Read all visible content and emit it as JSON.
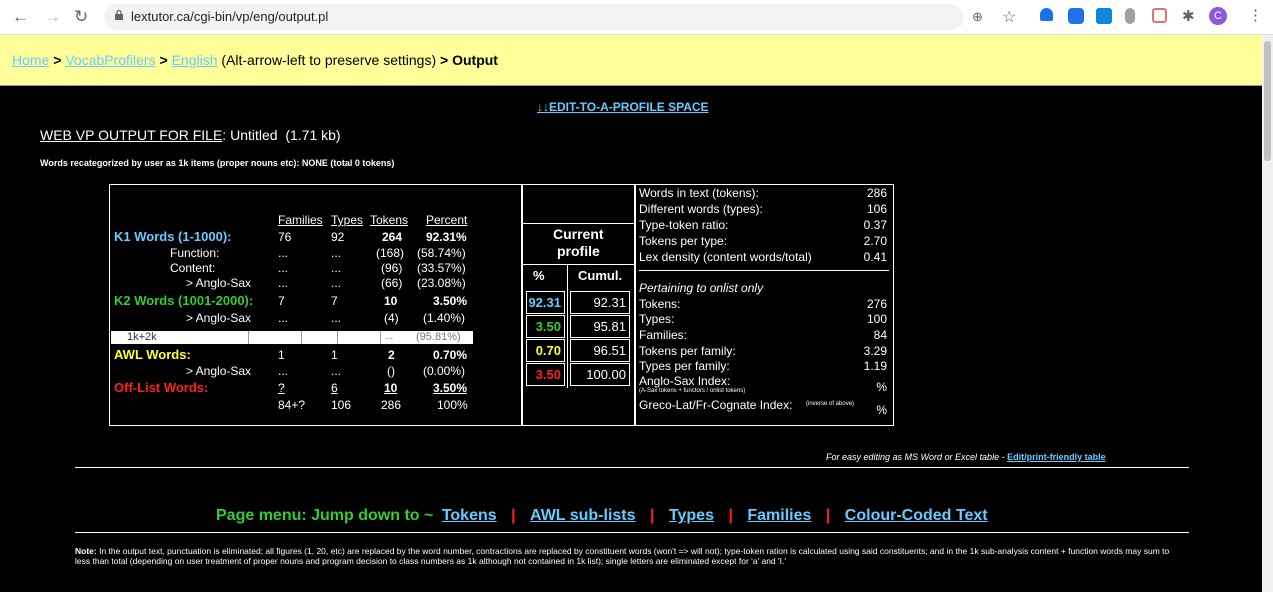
{
  "browser": {
    "url": "lextutor.ca/cgi-bin/vp/eng/output.pl"
  },
  "breadcrumb": {
    "home": "Home",
    "sep1": ">",
    "vocabprofilers": "VocabProfilers",
    "sep2": ">",
    "english": "English",
    "hint": "(Alt-arrow-left to preserve settings)",
    "sep3": ">",
    "output": "Output"
  },
  "edit_link": "↓↓EDIT-TO-A-PROFILE SPACE",
  "vp_title": {
    "label": "WEB VP OUTPUT FOR FILE",
    "colon": ":",
    "file": "Untitled",
    "size": "(1.71 kb)"
  },
  "recategorized": "Words recategorized by user as 1k items (proper nouns etc): NONE (total 0 tokens)",
  "table": {
    "headers": {
      "families": "Families",
      "types": "Types",
      "tokens": "Tokens",
      "percent": "Percent"
    },
    "k1": {
      "label": "K1 Words (1-1000):",
      "families": "76",
      "types": "92",
      "tokens": "264",
      "percent": "92.31%"
    },
    "function": {
      "label": "Function:",
      "families": "...",
      "types": "...",
      "tokens": "(168)",
      "percent": "(58.74%)"
    },
    "content": {
      "label": "Content:",
      "families": "...",
      "types": "...",
      "tokens": "(96)",
      "percent": "(33.57%)"
    },
    "anglosax1": {
      "label": ">  Anglo-Sax",
      "families": "...",
      "types": "...",
      "tokens": "(66)",
      "percent": "(23.08%)"
    },
    "k2": {
      "label": "K2 Words (1001-2000):",
      "families": "7",
      "types": "7",
      "tokens": "10",
      "percent": "3.50%"
    },
    "anglosax2": {
      "label": ">  Anglo-Sax",
      "families": "...",
      "types": "...",
      "tokens": "(4)",
      "percent": "(1.40%)"
    },
    "k1k2": {
      "label": "1k+2k",
      "tokens": "...",
      "percent": "(95.81%)"
    },
    "awl": {
      "label": "AWL Words:",
      "families": "1",
      "types": "1",
      "tokens": "2",
      "percent": "0.70%"
    },
    "anglosax3": {
      "label": ">  Anglo-Sax",
      "families": "...",
      "types": "...",
      "tokens": "()",
      "percent": "(0.00%)"
    },
    "offlist": {
      "label": "Off-List Words:",
      "families": "?",
      "types": "6",
      "tokens": "10",
      "percent": "3.50%"
    },
    "total": {
      "families": "84+?",
      "types": "106",
      "tokens": "286",
      "percent": "100%"
    }
  },
  "current_profile": {
    "title_line1": "Current",
    "title_line2": "profile",
    "col_pct": "%",
    "col_cumul": "Cumul.",
    "rows": [
      {
        "pct": "92.31",
        "cumul": "92.31",
        "color": "#66ccff"
      },
      {
        "pct": "3.50",
        "cumul": "95.81",
        "color": "#33cc33"
      },
      {
        "pct": "0.70",
        "cumul": "96.51",
        "color": "#ffff33"
      },
      {
        "pct": "3.50",
        "cumul": "100.00",
        "color": "#ff2020"
      }
    ]
  },
  "stats": {
    "tokens": {
      "label": "Words in text (tokens):",
      "value": "286"
    },
    "types": {
      "label": "Different words (types):",
      "value": "106"
    },
    "ttr": {
      "label": "Type-token ratio:",
      "value": "0.37"
    },
    "tpt": {
      "label": "Tokens per type:",
      "value": "2.70"
    },
    "lex": {
      "label": "Lex density (content words/total)",
      "value": "0.41"
    },
    "onlist_heading": "Pertaining to onlist only",
    "on_tokens": {
      "label": "Tokens:",
      "value": "276"
    },
    "on_types": {
      "label": "Types:",
      "value": "100"
    },
    "on_families": {
      "label": "Families:",
      "value": "84"
    },
    "on_tpf": {
      "label": "Tokens per family:",
      "value": "3.29"
    },
    "on_typf": {
      "label": "Types per family:",
      "value": "1.19"
    },
    "anglosax_index": {
      "label": "Anglo-Sax Index:",
      "sub": "(A-Sax tokens + functors / onlist tokens)",
      "value": "%"
    },
    "greco_index": {
      "label": "Greco-Lat/Fr-Cognate Index:",
      "sub": "(inverse of above)",
      "value": "%"
    }
  },
  "edit_print": {
    "text": "For easy editing as MS Word or Excel table -",
    "link": "Edit/print-friendly table"
  },
  "page_menu": {
    "label": "Page menu: Jump down to ~",
    "tokens": "Tokens",
    "awl": "AWL sub-lists",
    "types": "Types",
    "families": "Families",
    "colour": "Colour-Coded Text",
    "sep": "|"
  },
  "note": {
    "bold": "Note:",
    "text": "In the output text, punctuation is eliminated; all figures (1, 20, etc) are replaced by the word number, contractions are replaced by constituent words (won't => will not); type-token ration is calculated using said constituents; and in the 1k sub-analysis content + function words may sum to less than total (depending on user treatment of proper nouns and program decision to class numbers as 1k although not contained in 1k list); single letters are eliminated except for 'a' and 'I.'"
  }
}
